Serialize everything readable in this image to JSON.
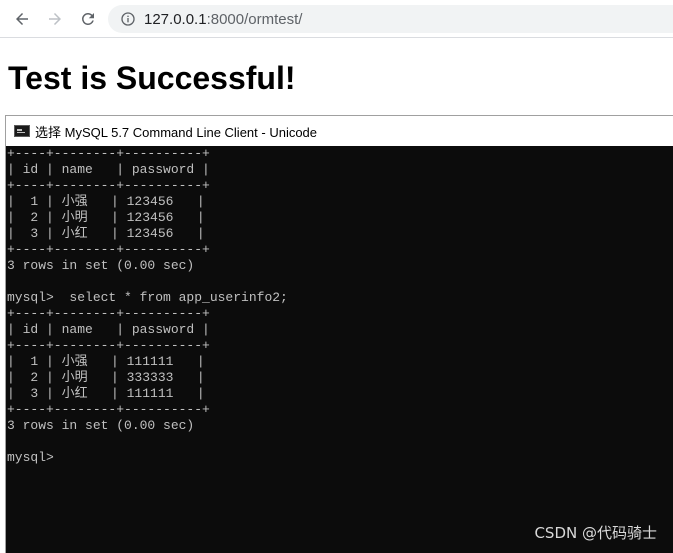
{
  "browser": {
    "url_host": "127.0.0.1",
    "url_path": ":8000/ormtest/"
  },
  "page": {
    "heading": "Test is Successful!"
  },
  "console": {
    "title": "选择 MySQL 5.7 Command Line Client - Unicode",
    "lines": [
      "+----+--------+----------+",
      "| id | name   | password |",
      "+----+--------+----------+",
      "|  1 | 小强   | 123456   |",
      "|  2 | 小明   | 123456   |",
      "|  3 | 小红   | 123456   |",
      "+----+--------+----------+",
      "3 rows in set (0.00 sec)",
      "",
      "mysql>  select * from app_userinfo2;",
      "+----+--------+----------+",
      "| id | name   | password |",
      "+----+--------+----------+",
      "|  1 | 小强   | 111111   |",
      "|  2 | 小明   | 333333   |",
      "|  3 | 小红   | 111111   |",
      "+----+--------+----------+",
      "3 rows in set (0.00 sec)",
      "",
      "mysql>"
    ]
  },
  "watermark": "CSDN @代码骑士",
  "colors": {
    "console_bg": "#0c0c0c",
    "console_text": "#c0c0c0",
    "address_bar_bg": "#f1f3f4"
  },
  "icons": {
    "back": "arrow-left-icon",
    "forward": "arrow-right-icon",
    "reload": "reload-icon",
    "site_info": "info-icon",
    "console_app": "console-app-icon"
  }
}
